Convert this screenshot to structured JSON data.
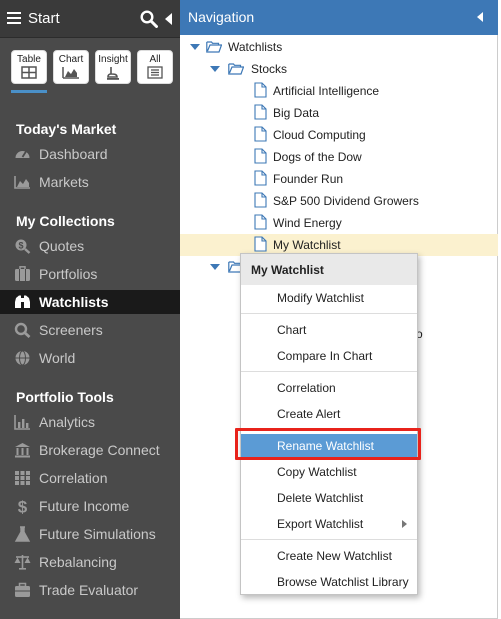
{
  "sidebar": {
    "title": "Start",
    "view_buttons": [
      {
        "label": "Table",
        "icon": "table-icon"
      },
      {
        "label": "Chart",
        "icon": "chart-icon"
      },
      {
        "label": "Insight",
        "icon": "insight-icon"
      },
      {
        "label": "All",
        "icon": "all-icon"
      }
    ],
    "sections": [
      {
        "title": "Today's Market",
        "items": [
          {
            "label": "Dashboard",
            "icon": "dashboard-icon"
          },
          {
            "label": "Markets",
            "icon": "markets-icon"
          }
        ]
      },
      {
        "title": "My Collections",
        "items": [
          {
            "label": "Quotes",
            "icon": "quotes-icon"
          },
          {
            "label": "Portfolios",
            "icon": "portfolios-icon"
          },
          {
            "label": "Watchlists",
            "icon": "binoculars-icon",
            "active": true
          },
          {
            "label": "Screeners",
            "icon": "screeners-icon"
          },
          {
            "label": "World",
            "icon": "globe-icon"
          }
        ]
      },
      {
        "title": "Portfolio Tools",
        "items": [
          {
            "label": "Analytics",
            "icon": "analytics-icon"
          },
          {
            "label": "Brokerage Connect",
            "icon": "bank-icon"
          },
          {
            "label": "Correlation",
            "icon": "grid-icon"
          },
          {
            "label": "Future Income",
            "icon": "dollar-icon"
          },
          {
            "label": "Future Simulations",
            "icon": "flask-icon"
          },
          {
            "label": "Rebalancing",
            "icon": "scale-icon"
          },
          {
            "label": "Trade Evaluator",
            "icon": "briefcase-icon"
          }
        ]
      }
    ]
  },
  "navigation": {
    "title": "Navigation",
    "tree": {
      "root": "Watchlists",
      "group": "Stocks",
      "items": [
        "Artificial Intelligence",
        "Big Data",
        "Cloud Computing",
        "Dogs of the Dow",
        "Founder Run",
        "S&P 500 Dividend Growers",
        "Wind Energy",
        "My Watchlist"
      ],
      "selected": "My Watchlist",
      "obscured_partial_text": "o"
    }
  },
  "context_menu": {
    "title": "My Watchlist",
    "groups": [
      [
        "Modify Watchlist"
      ],
      [
        "Chart",
        "Compare In Chart"
      ],
      [
        "Correlation",
        "Create Alert"
      ],
      [
        "Rename Watchlist",
        "Copy Watchlist",
        "Delete Watchlist",
        "Export Watchlist"
      ],
      [
        "Create New Watchlist",
        "Browse Watchlist Library"
      ]
    ],
    "highlighted": "Rename Watchlist",
    "submenu_item": "Export Watchlist",
    "highlight_color": "#5b9bd5",
    "annotation_color": "#e8231b"
  },
  "colors": {
    "sidebar_bg": "#4a4a4a",
    "nav_header_bg": "#3d78b6",
    "selection_bg": "#fbf1cf"
  }
}
